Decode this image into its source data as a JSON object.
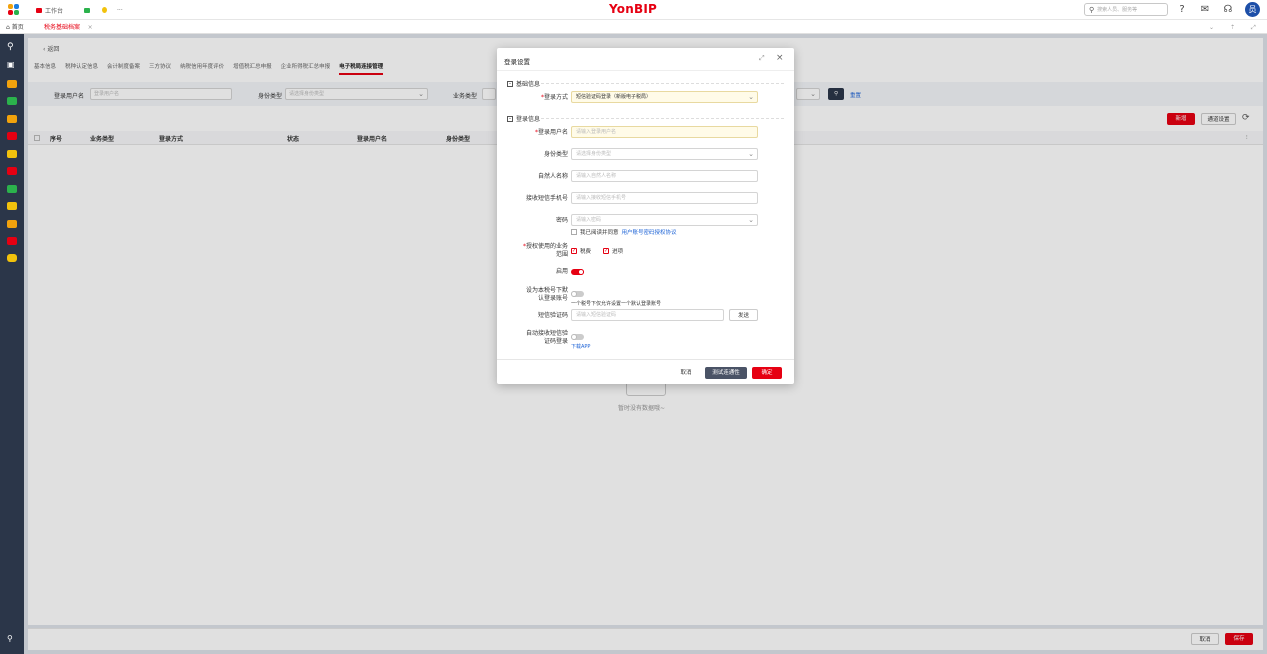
{
  "topbar": {
    "workbench_tab": "工作台",
    "more": "···",
    "brand": "YonBIP",
    "search_placeholder": "搜索人员、服务等",
    "avatar": "员"
  },
  "tabs": {
    "home": "首页",
    "active": "税务基础档案",
    "close": "×"
  },
  "page": {
    "back": "返回",
    "subtabs": [
      "基本信息",
      "税种认定信息",
      "会计制度备案",
      "三方协议",
      "纳税信用年度评价",
      "增值税汇总申报",
      "企业所得税汇总申报",
      "电子税局连接管理"
    ],
    "active_subtab": "电子税局连接管理",
    "filter": {
      "login_user_label": "登录用户名",
      "login_user_placeholder": "登录用户名",
      "identity_label": "身份类型",
      "identity_placeholder": "请选择身份类型",
      "biz_type_label": "业务类型",
      "reset": "重置"
    },
    "toolbar": {
      "new": "新增",
      "settings": "通道设置"
    },
    "columns": [
      "序号",
      "业务类型",
      "登录方式",
      "状态",
      "登录用户名",
      "身份类型"
    ],
    "empty_text": "暂时没有数据哦~",
    "footer": {
      "cancel": "取消",
      "save": "保存"
    }
  },
  "modal": {
    "title": "登录设置",
    "section_basic": "基础信息",
    "login_method_label": "登录方式",
    "login_method_value": "短信验证码登录（新版电子税局）",
    "section_login": "登录信息",
    "username_label": "登录用户名",
    "username_placeholder": "请输入登录用户名",
    "identity_label": "身份类型",
    "identity_placeholder": "请选择身份类型",
    "natural_name_label": "自然人名称",
    "natural_name_placeholder": "请输入自然人名称",
    "sms_phone_label": "接收短信手机号",
    "sms_phone_placeholder": "请输入接收短信手机号",
    "password_label": "密码",
    "password_placeholder": "请输入密码",
    "agree_text": "我已阅读并同意",
    "agree_link": "用户账号密码授权协议",
    "scope_label_1": "授权使用的业务",
    "scope_label_2": "范围",
    "scope_opt1": "税费",
    "scope_opt2": "进项",
    "enable_label": "启用",
    "enabled": true,
    "default_label_1": "设为本税号下默",
    "default_label_2": "认登录账号",
    "default_enabled": false,
    "default_hint": "一个税号下仅允许设置一个默认登录账号",
    "sms_code_label": "短信验证码",
    "sms_code_placeholder": "请输入短信验证码",
    "send": "发送",
    "auto_sms_label_1": "自动接收短信验",
    "auto_sms_label_2": "证码登录",
    "auto_sms_enabled": false,
    "download_app": "下载APP",
    "cancel": "取消",
    "test": "测试连通性",
    "confirm": "确定"
  }
}
